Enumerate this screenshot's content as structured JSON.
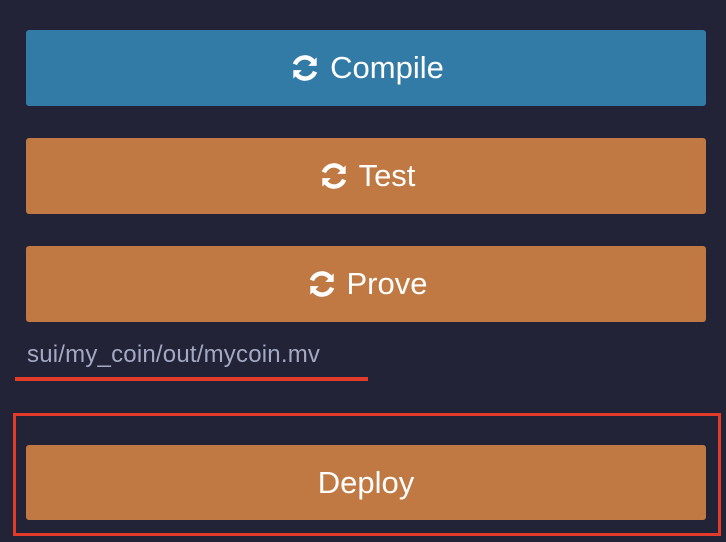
{
  "buttons": {
    "compile_label": "Compile",
    "test_label": "Test",
    "prove_label": "Prove",
    "deploy_label": "Deploy"
  },
  "output_path": "sui/my_coin/out/mycoin.mv",
  "icons": {
    "compile": "refresh-icon",
    "test": "refresh-icon",
    "prove": "refresh-icon"
  },
  "colors": {
    "background": "#222336",
    "compile": "#337ba7",
    "action": "#c07942",
    "annotation": "#e23b2a",
    "path_text": "#a3a8c4"
  }
}
